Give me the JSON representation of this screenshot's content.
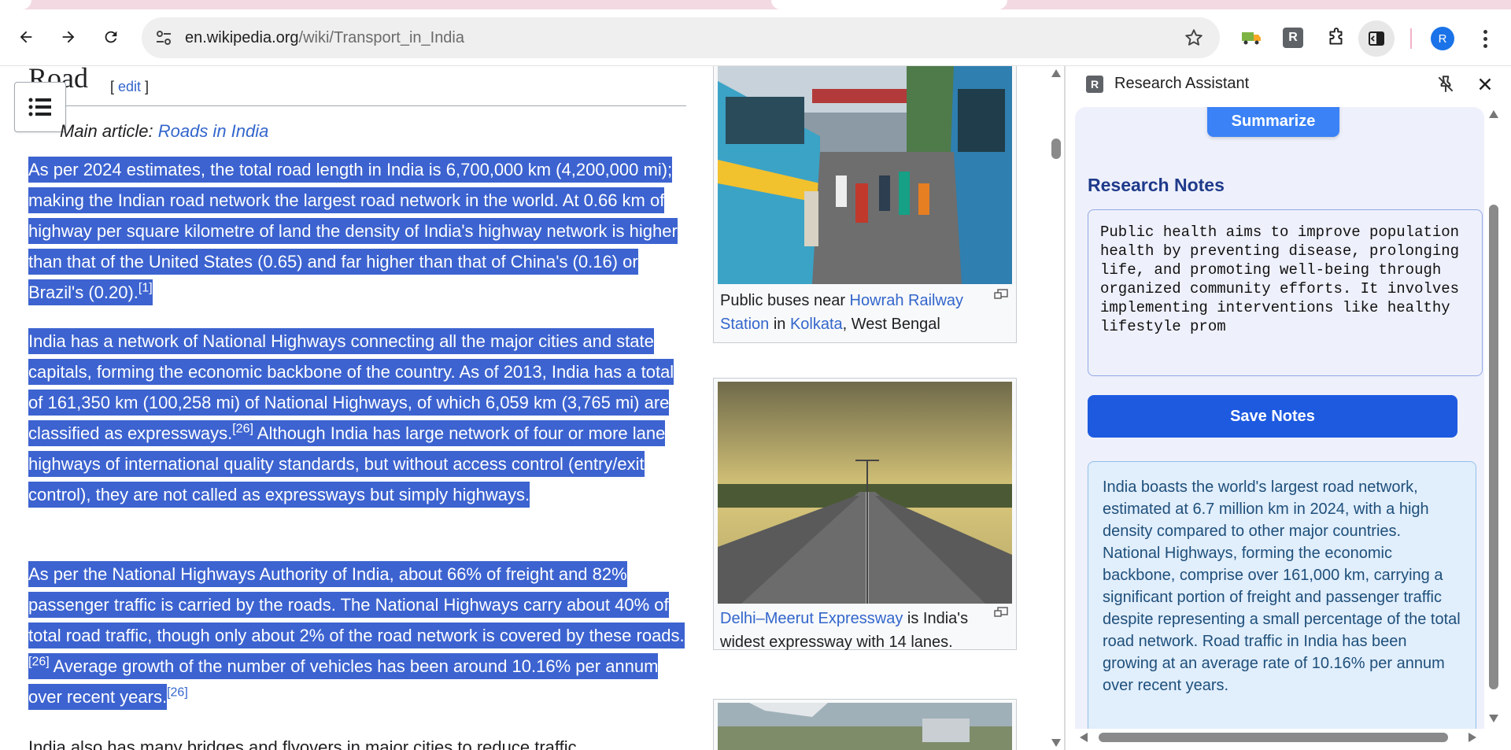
{
  "browser": {
    "url_host": "en.wikipedia.org",
    "url_path": "/wiki/Transport_in_India",
    "profile_initial": "R",
    "extension_r_label": "R"
  },
  "article": {
    "heading": "Road",
    "edit_open": "[ ",
    "edit_label": "edit",
    "edit_close": " ]",
    "hatnote_prefix": "Main article: ",
    "hatnote_link": "Roads in India",
    "paragraphs": {
      "p1": {
        "text": "As per 2024 estimates, the total road length in India is 6,700,000 km (4,200,000 mi); making the Indian road network the largest road network in the world. At 0.66 km of highway per square kilometre of land the density of India's highway network is higher than that of the United States (0.65) and far higher than that of China's (0.16) or Brazil's (0.20).",
        "ref": "[1]"
      },
      "p2": {
        "text_a": "India has a network of National Highways connecting all the major cities and state capitals, forming the economic backbone of the country. As of 2013, India has a total of 161,350 km (100,258 mi) of National Highways, of which 6,059 km (3,765 mi) are classified as expressways.",
        "ref_a": "[26]",
        "text_b": " Although India has large network of four or more lane highways of international quality standards, but without access control (entry/exit control), they are not called as expressways but simply highways."
      },
      "p3": {
        "text_a": "As per the National Highways Authority of India, about 66% of freight and 82% passenger traffic is carried by the roads. The National Highways carry about 40% of total road traffic, though only about 2% of the road network is covered by these roads.",
        "ref_a": "[26]",
        "text_b": " Average growth of the number of vehicles has been around 10.16% per annum over recent years.",
        "ref_b": "[26]"
      },
      "p4": {
        "text": "India also has many bridges and flyovers in major cities to reduce traffic"
      }
    },
    "figures": [
      {
        "caption_a": "Public buses near ",
        "link_a": "Howrah Railway Station",
        "caption_b": " in ",
        "link_b": "Kolkata",
        "caption_c": ", West Bengal"
      },
      {
        "link_a": "Delhi–Meerut Expressway",
        "caption_a": " is India's widest expressway with 14 lanes."
      }
    ]
  },
  "side_panel": {
    "logo_letter": "R",
    "title": "Research Assistant",
    "summarize_label": "Summarize",
    "notes_title": "Research Notes",
    "notes_text": "Public health aims to improve population health by preventing disease, prolonging life, and promoting well-being through organized community efforts. It involves implementing interventions like healthy lifestyle prom",
    "save_label": "Save Notes",
    "summary_text": "India boasts the world's largest road network, estimated at 6.7 million km in 2024, with a high density compared to other major countries. National Highways, forming the economic backbone, comprise over 161,000 km, carrying a significant portion of freight and passenger traffic despite representing a small percentage of the total road network. Road traffic in India has been growing at an average rate of 10.16% per annum over recent years."
  },
  "icons": {
    "back": "back-arrow-icon",
    "forward": "forward-arrow-icon",
    "reload": "reload-icon",
    "site_info": "site-info-icon",
    "bookmark": "star-icon",
    "truck_extension": "truck-icon",
    "extensions": "puzzle-icon",
    "side_panel": "side-panel-icon",
    "menu": "kebab-menu-icon",
    "toc": "list-icon",
    "pin": "unpin-icon",
    "close": "close-icon"
  },
  "colors": {
    "selection": "#3c63d0",
    "link": "#3366cc",
    "panel_bg": "#eef0fb",
    "save_button": "#1d5ae0",
    "summarize_button": "#3b82f6",
    "notes_title": "#1e3a8a",
    "summary_bg": "#e1eefc"
  }
}
